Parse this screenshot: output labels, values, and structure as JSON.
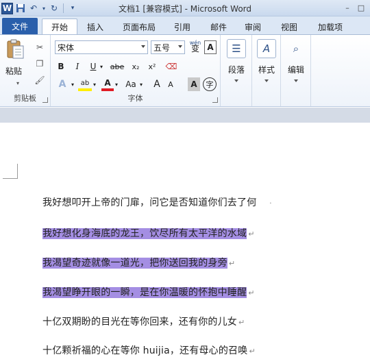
{
  "titlebar": {
    "title": "文档1 [兼容模式] - Microsoft Word",
    "logo": "W",
    "minimize": "–",
    "maximize": "□"
  },
  "tabs": {
    "file": "文件",
    "items": [
      "开始",
      "插入",
      "页面布局",
      "引用",
      "邮件",
      "审阅",
      "视图",
      "加载项"
    ]
  },
  "ribbon": {
    "clipboard": {
      "paste": "粘贴",
      "label": "剪贴板"
    },
    "font": {
      "name": "宋体",
      "size": "五号",
      "bold": "B",
      "italic": "I",
      "underline": "U",
      "strike": "abe",
      "subscript": "x₂",
      "superscript": "x²",
      "change_case": "Aa",
      "grow": "A",
      "shrink": "A",
      "char_shading": "A",
      "enclose": "字",
      "wen": "wén",
      "wen_char": "变",
      "label": "字体"
    },
    "paragraph": {
      "label": "段落"
    },
    "styles": {
      "label": "样式"
    },
    "editing": {
      "label": "编辑"
    }
  },
  "document": {
    "lines": [
      "我好想叩开上帝的门扉，问它是否知道你们去了何",
      "我好想化身海底的龙王，饮尽所有太平洋的水域",
      "我渴望奇迹就像一道光，把你送回我的身旁",
      "我渴望睁开眼的一瞬，是在你温暖的怀抱中睡醒",
      "十亿双期盼的目光在等你回来，还有你的儿女",
      "十亿颗祈福的心在等你 huijia，还有母心的召唤"
    ],
    "pilcrow": "↵"
  },
  "colors": {
    "file_tab": "#2a5fab",
    "highlight": "#a48ee3",
    "ribbon_bg": "#eef3fa"
  }
}
